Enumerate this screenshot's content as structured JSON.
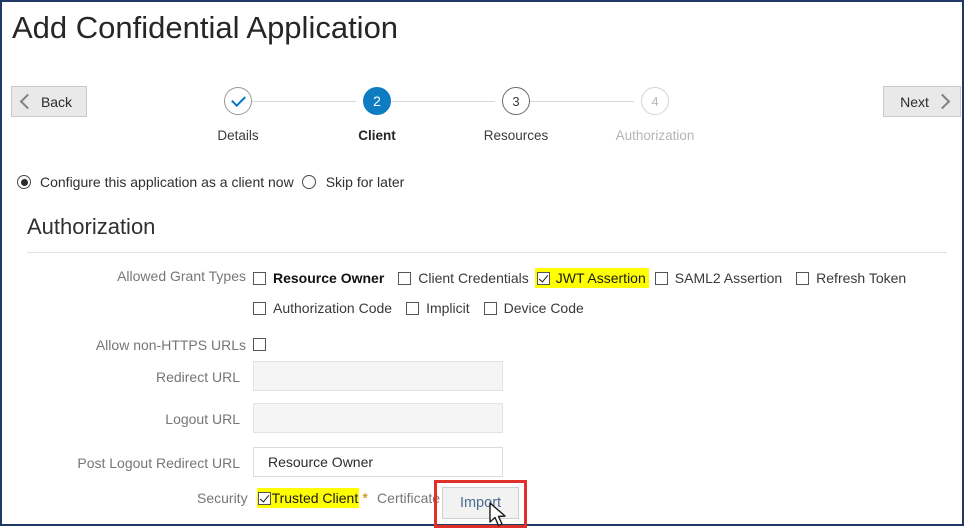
{
  "page": {
    "title": "Add Confidential Application",
    "border_color": "#1f3864"
  },
  "nav": {
    "back_label": "Back",
    "next_label": "Next"
  },
  "stepper": {
    "steps": [
      {
        "number": "1",
        "label": "Details",
        "state": "done",
        "glyph": "check"
      },
      {
        "number": "2",
        "label": "Client",
        "state": "active",
        "glyph": "2"
      },
      {
        "number": "3",
        "label": "Resources",
        "state": "todo",
        "glyph": "3"
      },
      {
        "number": "4",
        "label": "Authorization",
        "state": "disabled",
        "glyph": "4"
      }
    ],
    "active_color": "#0e7cc0"
  },
  "client_mode": {
    "configure_label": "Configure this application as a client now",
    "skip_label": "Skip for later",
    "selected": "configure"
  },
  "section": {
    "heading": "Authorization"
  },
  "form": {
    "grant_types_label": "Allowed Grant Types",
    "grant_types_row1": [
      {
        "label": "Resource Owner",
        "checked": false,
        "highlighted": false,
        "emphasis": true
      },
      {
        "label": "Client Credentials",
        "checked": false,
        "highlighted": false,
        "emphasis": false
      },
      {
        "label": "JWT Assertion",
        "checked": true,
        "highlighted": true,
        "emphasis": false
      },
      {
        "label": "SAML2 Assertion",
        "checked": false,
        "highlighted": false,
        "emphasis": false
      },
      {
        "label": "Refresh Token",
        "checked": false,
        "highlighted": false,
        "emphasis": false
      }
    ],
    "grant_types_row2": [
      {
        "label": "Authorization Code",
        "checked": false,
        "highlighted": false,
        "emphasis": false
      },
      {
        "label": "Implicit",
        "checked": false,
        "highlighted": false,
        "emphasis": false
      },
      {
        "label": "Device Code",
        "checked": false,
        "highlighted": false,
        "emphasis": false
      }
    ],
    "allow_non_https_label": "Allow non-HTTPS URLs",
    "allow_non_https_checked": false,
    "redirect_url_label": "Redirect URL",
    "redirect_url_value": "",
    "logout_url_label": "Logout URL",
    "logout_url_value": "",
    "post_logout_redirect_url_label": "Post Logout Redirect URL",
    "post_logout_redirect_url_value": "Resource Owner",
    "security_label": "Security",
    "trusted_client_label": "Trusted Client",
    "trusted_client_checked": true,
    "required_marker": "*",
    "certificate_label": "Certificate",
    "import_button_label": "Import"
  },
  "highlights": {
    "marker_color": "#ffff00",
    "callout_border_color": "#e0302a"
  }
}
